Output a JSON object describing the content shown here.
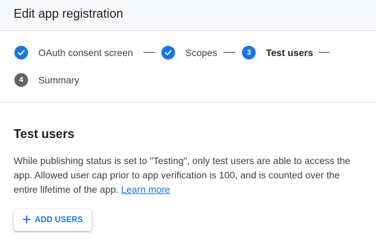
{
  "header": {
    "title": "Edit app registration"
  },
  "stepper": {
    "steps": [
      {
        "label": "OAuth consent screen",
        "status": "done",
        "icon": "check-icon"
      },
      {
        "label": "Scopes",
        "status": "done",
        "icon": "check-icon"
      },
      {
        "label": "Test users",
        "status": "current",
        "number": "3"
      },
      {
        "label": "Summary",
        "status": "upcoming",
        "number": "4"
      }
    ]
  },
  "section": {
    "title": "Test users",
    "description": "While publishing status is set to \"Testing\", only test users are able to access the app. Allowed user cap prior to app verification is 100, and is counted over the entire lifetime of the app.",
    "learn_more": "Learn more"
  },
  "add_users_button": {
    "label": "ADD USERS",
    "icon": "plus-icon"
  },
  "colors": {
    "accent": "#1a73e8",
    "upcoming_step": "#5f6368",
    "header_bg": "#f8f9fa"
  }
}
